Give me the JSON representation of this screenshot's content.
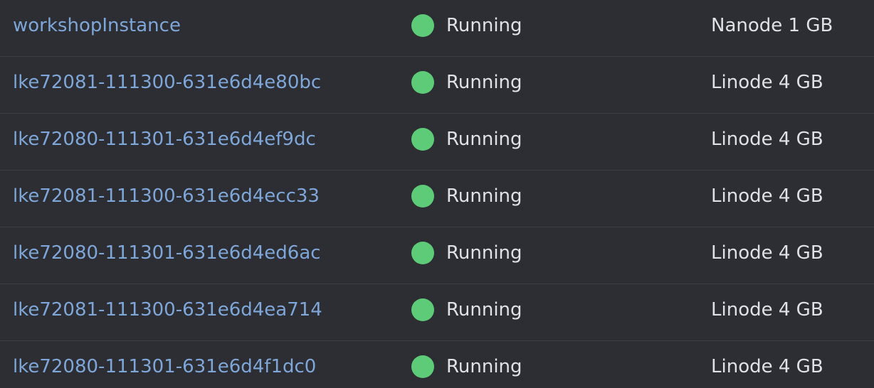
{
  "instances": [
    {
      "name": "workshopInstance",
      "status": "Running",
      "plan": "Nanode 1 GB"
    },
    {
      "name": "lke72081-111300-631e6d4e80bc",
      "status": "Running",
      "plan": "Linode 4 GB"
    },
    {
      "name": "lke72080-111301-631e6d4ef9dc",
      "status": "Running",
      "plan": "Linode 4 GB"
    },
    {
      "name": "lke72081-111300-631e6d4ecc33",
      "status": "Running",
      "plan": "Linode 4 GB"
    },
    {
      "name": "lke72080-111301-631e6d4ed6ac",
      "status": "Running",
      "plan": "Linode 4 GB"
    },
    {
      "name": "lke72081-111300-631e6d4ea714",
      "status": "Running",
      "plan": "Linode 4 GB"
    },
    {
      "name": "lke72080-111301-631e6d4f1dc0",
      "status": "Running",
      "plan": "Linode 4 GB"
    }
  ],
  "colors": {
    "link": "#7ea6d8",
    "status_running": "#5ecb79",
    "text": "#dfe1e5",
    "background": "#2c2e33"
  },
  "icons": {
    "status": "status-running-icon"
  }
}
